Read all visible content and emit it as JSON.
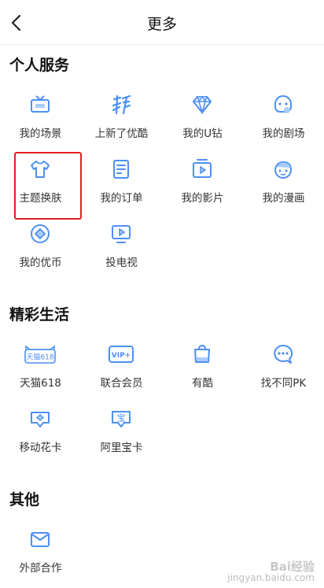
{
  "header": {
    "title": "更多"
  },
  "sections": [
    {
      "title": "个人服务",
      "items": [
        {
          "label": "我的场景",
          "icon": "tv-icon"
        },
        {
          "label": "上新了优酷",
          "icon": "new-brush-icon"
        },
        {
          "label": "我的U钻",
          "icon": "diamond-icon"
        },
        {
          "label": "我的剧场",
          "icon": "theater-icon"
        },
        {
          "label": "主题换肤",
          "icon": "tshirt-icon"
        },
        {
          "label": "我的订单",
          "icon": "order-icon"
        },
        {
          "label": "我的影片",
          "icon": "film-icon"
        },
        {
          "label": "我的漫画",
          "icon": "comic-face-icon"
        },
        {
          "label": "我的优币",
          "icon": "coin-icon"
        },
        {
          "label": "投电视",
          "icon": "cast-tv-icon"
        }
      ]
    },
    {
      "title": "精彩生活",
      "items": [
        {
          "label": "天猫618",
          "icon": "tmall-618-icon",
          "icon_text": "天猫618"
        },
        {
          "label": "联合会员",
          "icon": "vip-plus-icon",
          "icon_text": "VIP+"
        },
        {
          "label": "有酷",
          "icon": "bag-icon"
        },
        {
          "label": "找不同PK",
          "icon": "chat-bubble-icon"
        },
        {
          "label": "移动花卡",
          "icon": "card-icon"
        },
        {
          "label": "阿里宝卡",
          "icon": "bao-card-icon",
          "icon_text": "宝"
        }
      ]
    },
    {
      "title": "其他",
      "items": [
        {
          "label": "外部合作",
          "icon": "mail-icon"
        }
      ]
    }
  ],
  "watermark": {
    "main": "Bai经验",
    "sub": "jingyan.baidu.com"
  },
  "colors": {
    "icon_blue": "#4d8ff5",
    "highlight_red": "#e02020"
  }
}
